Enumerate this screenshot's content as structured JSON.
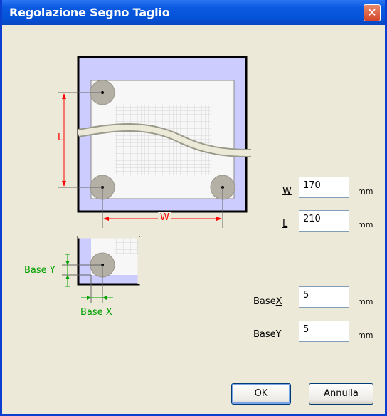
{
  "window": {
    "title": "Regolazione Segno Taglio",
    "close_glyph": "✕"
  },
  "diagram": {
    "label_L": "L",
    "label_W": "W",
    "label_base_y": "Base Y",
    "label_base_x": "Base X"
  },
  "fields": {
    "w": {
      "label": "W",
      "value": "170",
      "unit": "mm"
    },
    "l": {
      "label": "L",
      "value": "210",
      "unit": "mm"
    },
    "base_x": {
      "label_prefix": "Base",
      "label_access": "X",
      "value": "5",
      "unit": "mm"
    },
    "base_y": {
      "label_prefix": "Base",
      "label_access": "Y",
      "value": "5",
      "unit": "mm"
    }
  },
  "buttons": {
    "ok": "OK",
    "cancel": "Annulla"
  },
  "colors": {
    "titlebar": "#0553d8",
    "dialog_bg": "#ece9d8",
    "margin_fill": "#ccccff",
    "dimension_red": "#ff0000",
    "base_green": "#00a000"
  }
}
